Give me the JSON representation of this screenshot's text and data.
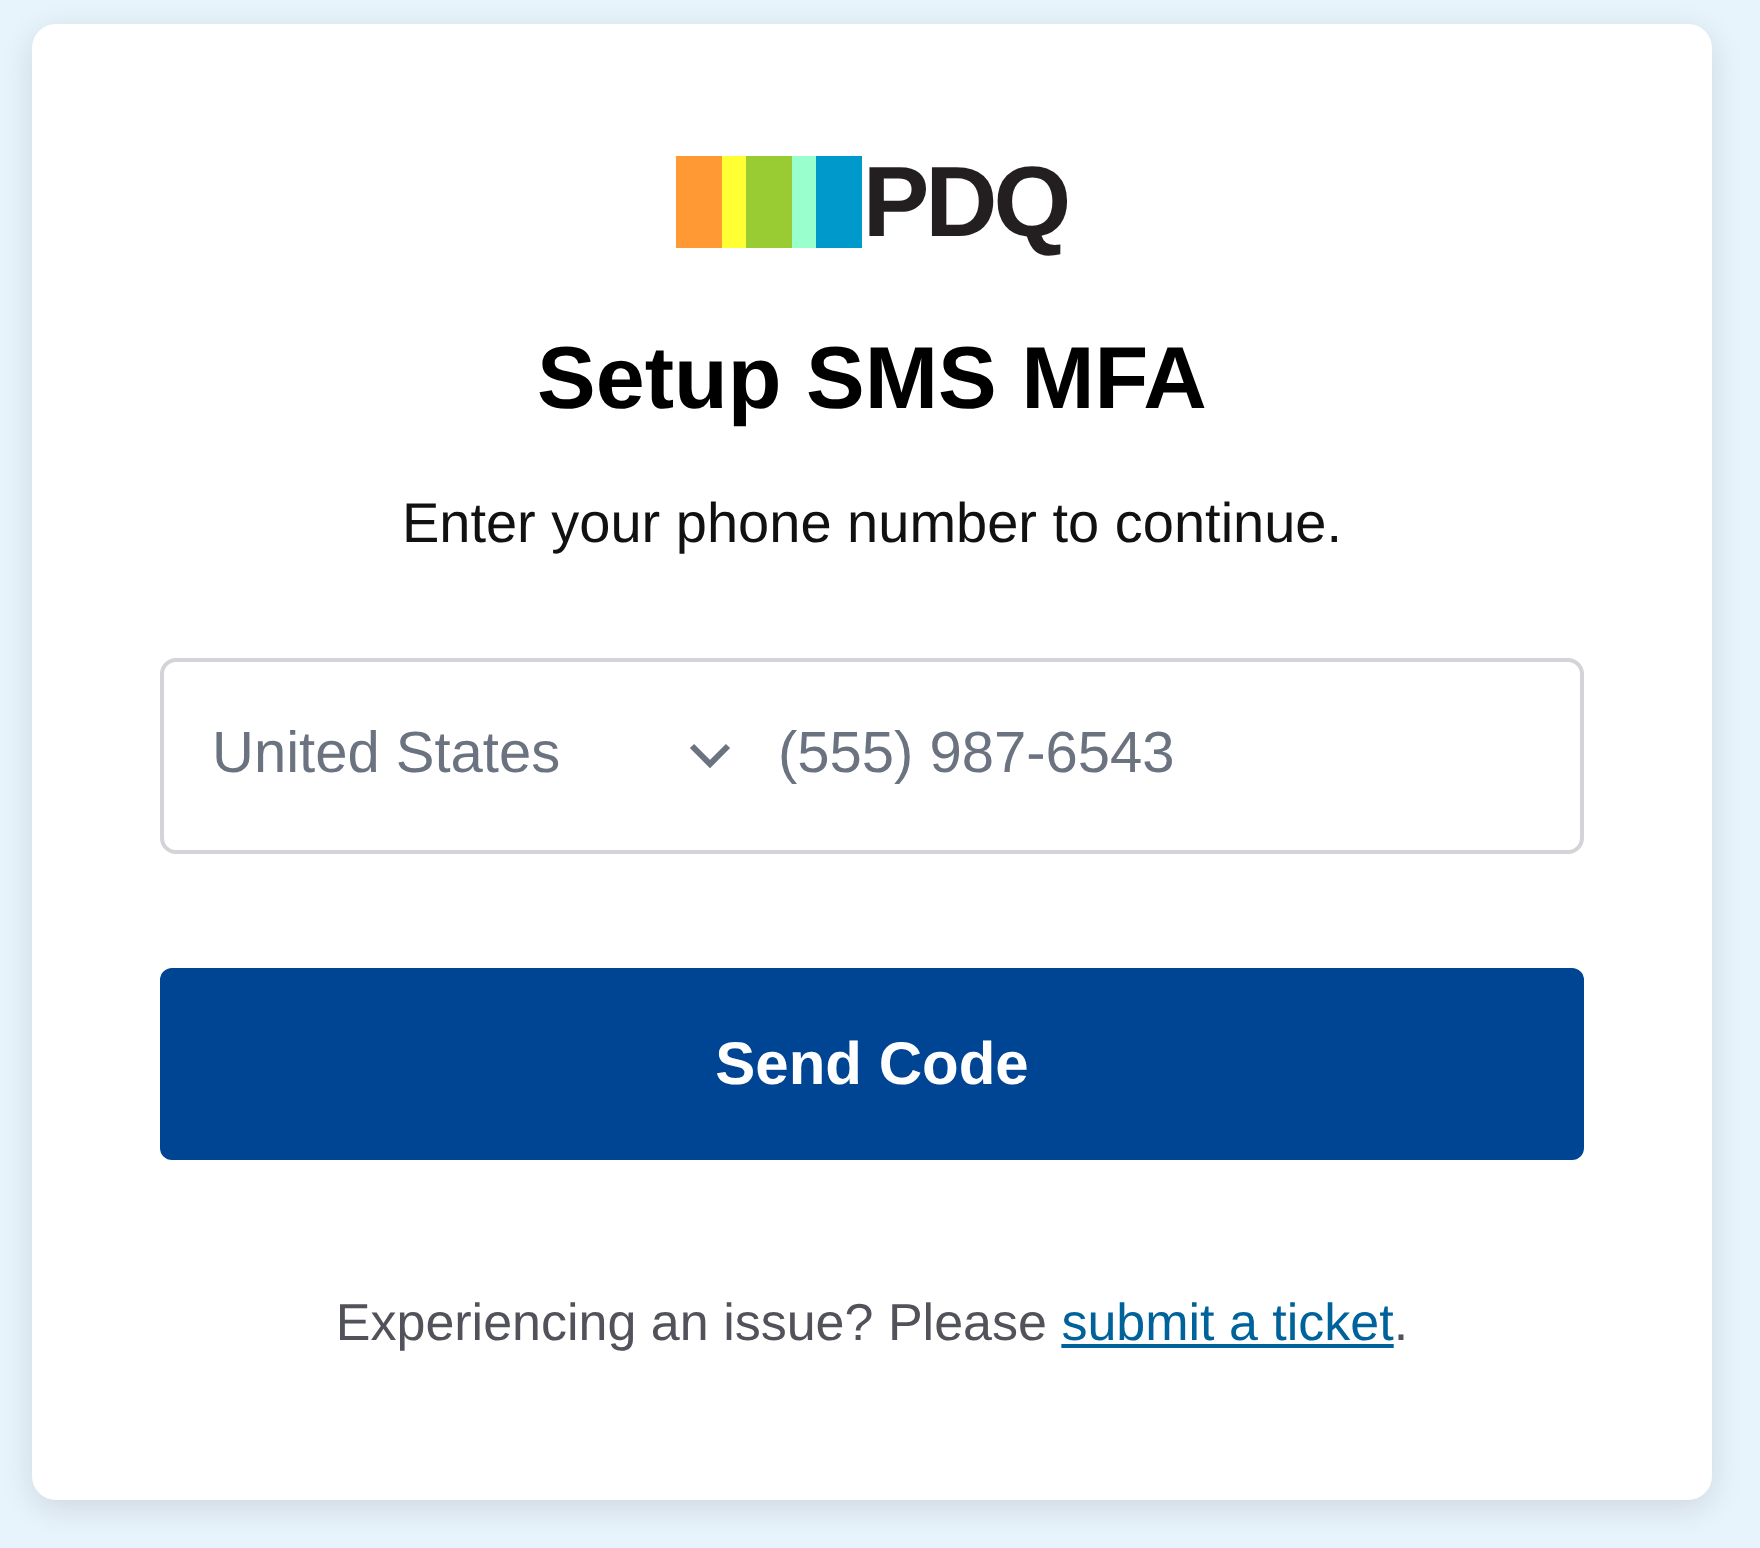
{
  "logo": {
    "text": "PDQ"
  },
  "title": "Setup SMS MFA",
  "subtitle": "Enter your phone number to continue.",
  "phone": {
    "country": "United States",
    "placeholder": "(555) 987-6543"
  },
  "button": "Send Code",
  "footer": {
    "text": "Experiencing an issue? Please",
    "link": "submit a ticket",
    "end": "."
  }
}
